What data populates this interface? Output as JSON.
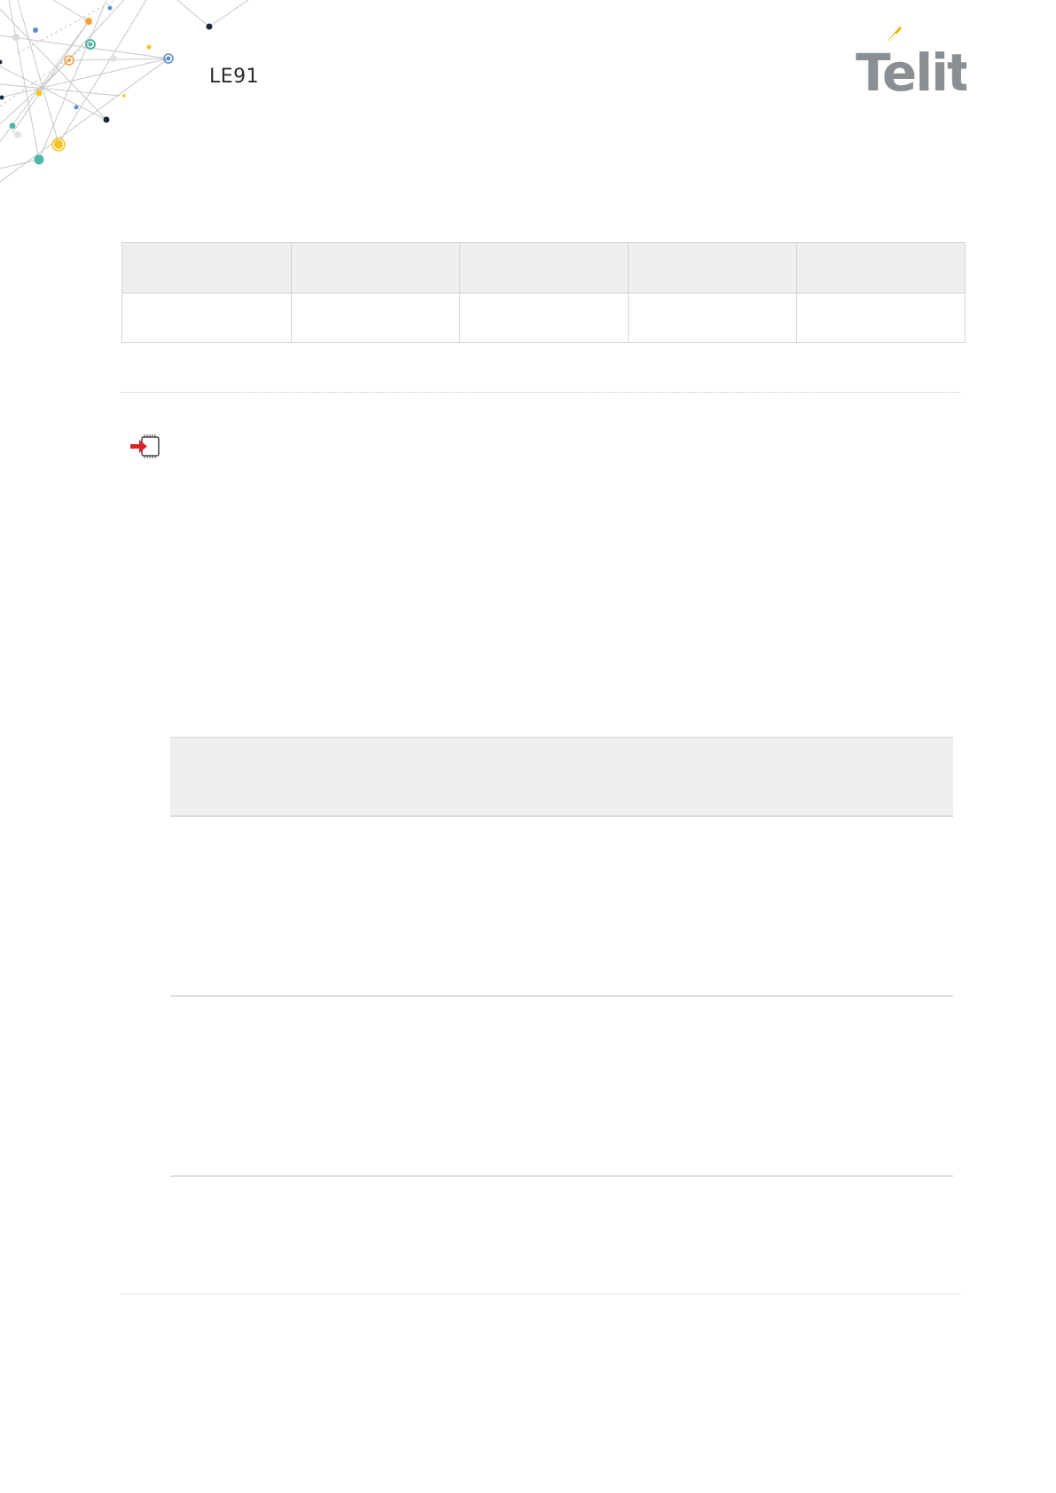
{
  "header": {
    "doc_title": "LE91",
    "logo_text": "Telit",
    "colors": {
      "logo_gray": "#8a8f94",
      "logo_accent": "#f5b400",
      "network_orange": "#f4a13a",
      "network_teal": "#4fb7a6",
      "network_blue": "#5b8fd1",
      "network_navy": "#1a2a3a",
      "network_yellow": "#f7c31d"
    }
  },
  "properties_table": {
    "columns": 5,
    "header_row": [
      "",
      "",
      "",
      "",
      ""
    ],
    "body_row": [
      "",
      "",
      "",
      "",
      ""
    ]
  },
  "section": {
    "icon": "module-arrow-icon"
  },
  "parameter_table": {
    "header": "",
    "rows": [
      "",
      "",
      ""
    ]
  }
}
